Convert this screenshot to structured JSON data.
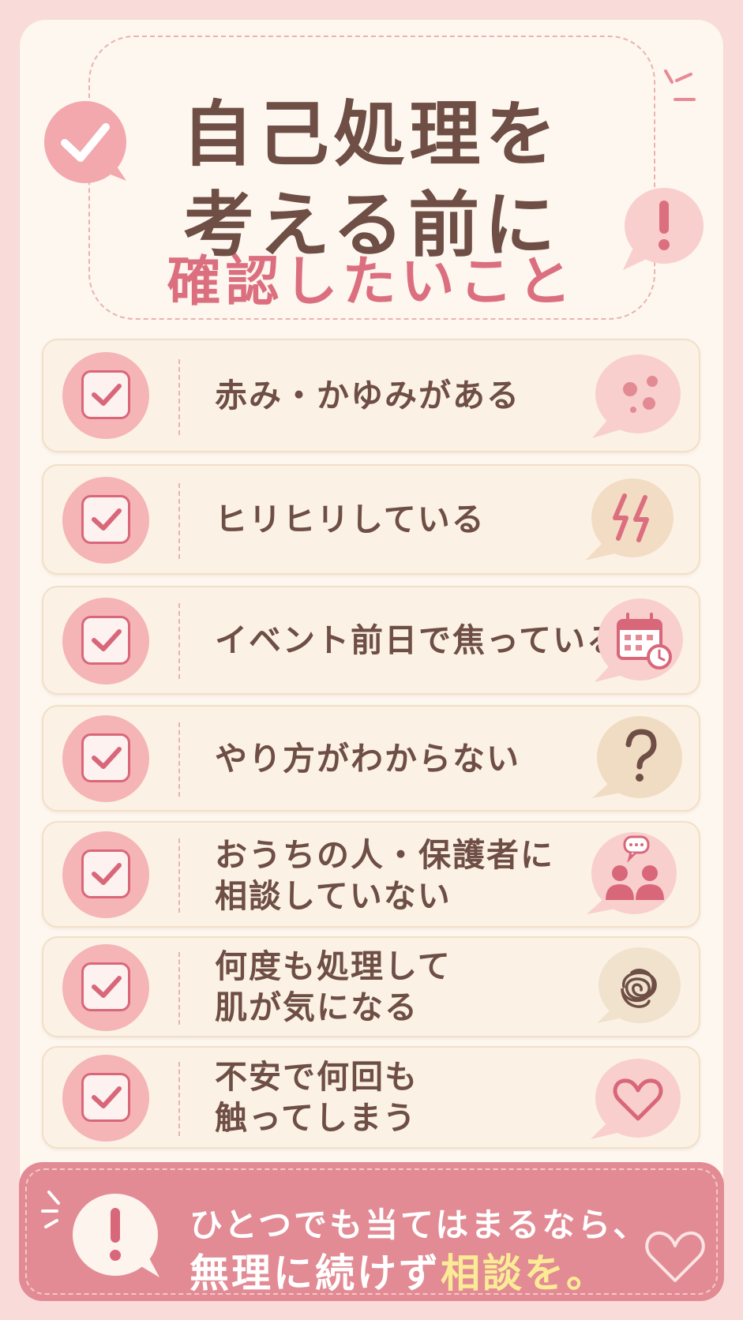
{
  "title": {
    "line1": "自己処理を",
    "line2": "考える前に",
    "line3": "確認したいこと"
  },
  "checklist": [
    {
      "lines": [
        "赤み・かゆみがある"
      ],
      "icon": "skin-dots-icon"
    },
    {
      "lines": [
        "ヒリヒリしている"
      ],
      "icon": "lightning-icon"
    },
    {
      "lines": [
        "イベント前日で焦っている"
      ],
      "icon": "calendar-clock-icon"
    },
    {
      "lines": [
        "やり方がわからない"
      ],
      "icon": "question-mark-icon"
    },
    {
      "lines": [
        "おうちの人・保護者に",
        "相談していない"
      ],
      "icon": "people-chat-icon"
    },
    {
      "lines": [
        "何度も処理して",
        "肌が気になる"
      ],
      "icon": "tangled-scribble-icon"
    },
    {
      "lines": [
        "不安で何回も",
        "触ってしまう"
      ],
      "icon": "heart-icon"
    }
  ],
  "banner": {
    "line1": "ひとつでも当てはまるなら、",
    "line2_prefix": "無理に続けず",
    "line2_highlight": "相談を。"
  },
  "colors": {
    "background": "#f9dcda",
    "card": "#fdf7ef",
    "title_brown": "#6e4e45",
    "accent_pink": "#dc6f7f",
    "banner": "#e28b94",
    "highlight_yellow": "#fbeb96"
  }
}
